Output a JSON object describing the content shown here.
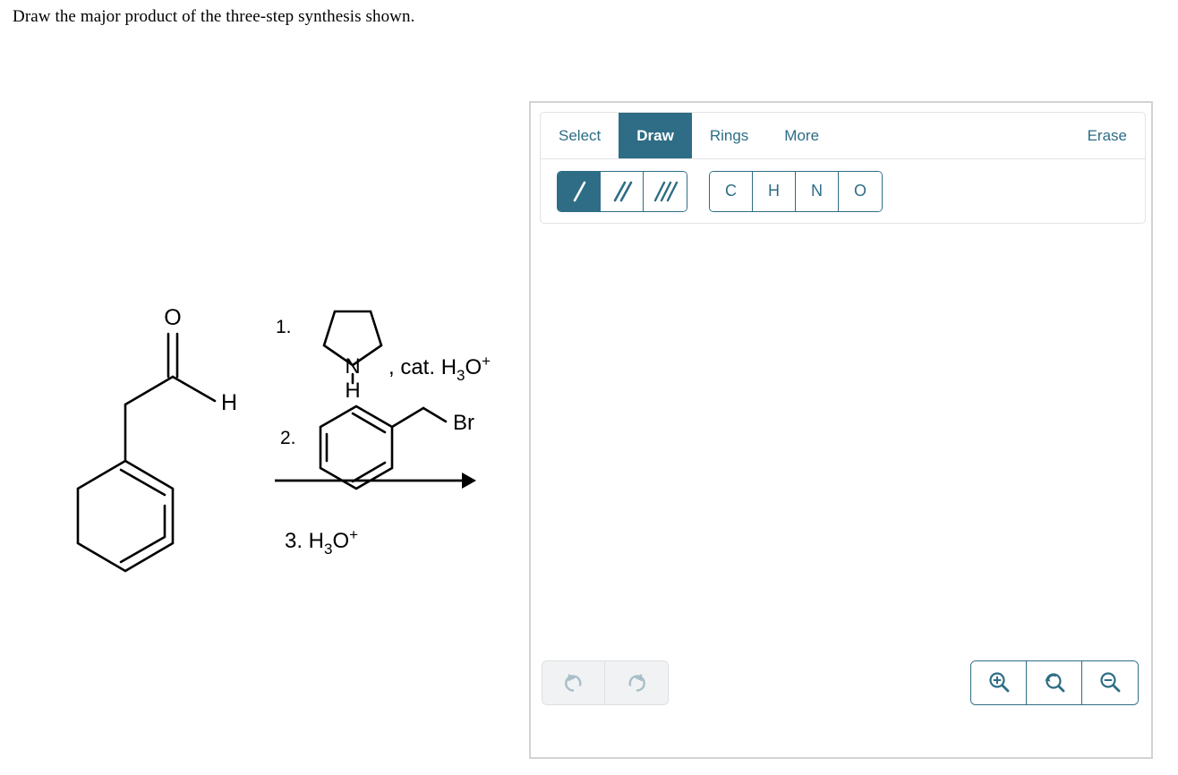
{
  "question": {
    "prompt": "Draw the major product of the three-step synthesis shown."
  },
  "reaction": {
    "reactant": {
      "name": "phenylacetaldehyde",
      "labels": {
        "oxygen": "O",
        "aldehyde_hydrogen": "H"
      }
    },
    "steps": [
      {
        "number": "1.",
        "reagent_structure": "pyrrolidine",
        "reagent_text": ", cat. H3O+",
        "n_label": "N",
        "nh_label": "H"
      },
      {
        "number": "2.",
        "reagent_structure": "benzyl bromide",
        "halide_label": "Br"
      },
      {
        "number": "3.",
        "reagent_text": "3. H3O+"
      }
    ]
  },
  "editor": {
    "tabs": [
      {
        "label": "Select",
        "active": false
      },
      {
        "label": "Draw",
        "active": true
      },
      {
        "label": "Rings",
        "active": false
      },
      {
        "label": "More",
        "active": false
      }
    ],
    "erase_label": "Erase",
    "bond_tools": [
      {
        "name": "single-bond",
        "selected": true
      },
      {
        "name": "double-bond",
        "selected": false
      },
      {
        "name": "triple-bond",
        "selected": false
      }
    ],
    "atom_tools": [
      {
        "label": "C"
      },
      {
        "label": "H"
      },
      {
        "label": "N"
      },
      {
        "label": "O"
      }
    ],
    "history": [
      {
        "name": "undo",
        "enabled": false
      },
      {
        "name": "redo",
        "enabled": false
      }
    ],
    "zoom_controls": [
      {
        "name": "zoom-in"
      },
      {
        "name": "zoom-reset"
      },
      {
        "name": "zoom-out"
      }
    ],
    "colors": {
      "accent": "#2e6d85",
      "panel_border": "#d2d3d5",
      "card_border": "#e2e3e5",
      "disabled_icon": "#a8bfc9",
      "disabled_bg": "#f1f2f3"
    }
  }
}
